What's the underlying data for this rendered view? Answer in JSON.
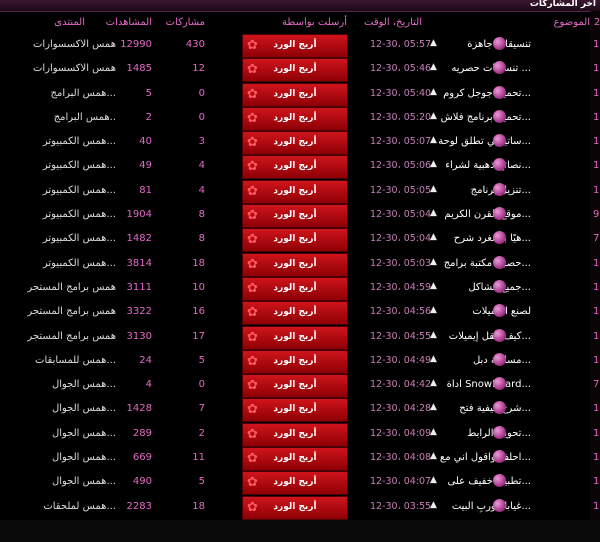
{
  "title": "آخر المشاركات",
  "headers": {
    "forum": "المنتدى",
    "views": "المشاهدات",
    "posts": "مشاركات",
    "sender": "أرسلت بواسطة",
    "date": "التاريخ، الوقت",
    "topic": "الموضوع",
    "num": "2"
  },
  "sender": "أريج الورد",
  "rows": [
    {
      "forum": "همس الاكسسوارات",
      "views": "12990",
      "posts": "430",
      "date": "12-30، 05:57",
      "topic": "تنسيقات جاهزة",
      "num": "1"
    },
    {
      "forum": "همس الاكسسوارات",
      "views": "1485",
      "posts": "12",
      "date": "12-30، 05:46",
      "topic": "تنسيقات حصريه ...",
      "num": "1"
    },
    {
      "forum": "همس البرامج...",
      "views": "5",
      "posts": "0",
      "date": "12-30، 05:40",
      "topic": "تحميل جوجل كروم...",
      "num": "1"
    },
    {
      "forum": "همس البرامج..",
      "views": "2",
      "posts": "0",
      "date": "12-30، 05:20",
      "topic": "تحميل برنامج فلاش...",
      "num": "1"
    },
    {
      "forum": "همس الكمبيوتر...",
      "views": "40",
      "posts": "3",
      "date": "12-30، 05:07",
      "topic": "ساتيشي تطلق لوحة...",
      "num": "1"
    },
    {
      "forum": "همس الكمبيوتر...",
      "views": "49",
      "posts": "4",
      "date": "12-30، 05:06",
      "topic": "نصائح ذهبية لشراء...",
      "num": "1"
    },
    {
      "forum": "همس الكمبيوتر...",
      "views": "81",
      "posts": "4",
      "date": "12-30، 05:05",
      "topic": "تنزيل برنامج...",
      "num": "1"
    },
    {
      "forum": "همس الكمبيوتر...",
      "views": "1904",
      "posts": "8",
      "date": "12-30، 05:04",
      "topic": "موقع القرن الكريم...",
      "num": "9"
    },
    {
      "forum": "همس الكمبيوتر...",
      "views": "1482",
      "posts": "8",
      "date": "12-30، 05:04",
      "topic": "هيًا بنا نغرد شرح...",
      "num": "7"
    },
    {
      "forum": "همس الكمبيوتر...",
      "views": "3814",
      "posts": "18",
      "date": "12-30، 05:03",
      "topic": "حصريا مكتبة برامج...",
      "num": "1"
    },
    {
      "forum": "همس برامج المستجر",
      "views": "3111",
      "posts": "10",
      "date": "12-30، 04:59",
      "topic": "جميع مشاكل...",
      "num": "1"
    },
    {
      "forum": "همس برامج المستجر",
      "views": "3322",
      "posts": "16",
      "date": "12-30، 04:56",
      "topic": "لصنع الايميلات",
      "num": "1"
    },
    {
      "forum": "همس برامج المستجر",
      "views": "3130",
      "posts": "17",
      "date": "12-30، 04:55",
      "topic": "كيف تنقل إيميلات...",
      "num": "1"
    },
    {
      "forum": "همس للمسابقات...",
      "views": "24",
      "posts": "5",
      "date": "12-30، 04:49",
      "topic": "مسابقة دبل...",
      "num": "1"
    },
    {
      "forum": "همس الجوال...",
      "views": "4",
      "posts": "0",
      "date": "12-30، 04:42",
      "topic": "اداة SnowBoard...",
      "num": "7"
    },
    {
      "forum": "همس الجوال...",
      "views": "1428",
      "posts": "7",
      "date": "12-30، 04:28",
      "topic": "شرح كيفية فتح...",
      "num": "1"
    },
    {
      "forum": "همس الجوال...",
      "views": "289",
      "posts": "2",
      "date": "12-30، 04:09",
      "topic": "تحويل الرابط...",
      "num": "1"
    },
    {
      "forum": "همس الجوال...",
      "views": "669",
      "posts": "11",
      "date": "12-30، 04:08",
      "topic": "احلف واقول اني مع...",
      "num": "1"
    },
    {
      "forum": "همس الجوال...",
      "views": "490",
      "posts": "5",
      "date": "12-30، 04:07",
      "topic": "تطبيق خفيف على...",
      "num": "1"
    },
    {
      "forum": "همس لملحقات...",
      "views": "2283",
      "posts": "18",
      "date": "12-30، 03:55",
      "topic": "غيابك وربِ البيت...",
      "num": "1"
    }
  ]
}
